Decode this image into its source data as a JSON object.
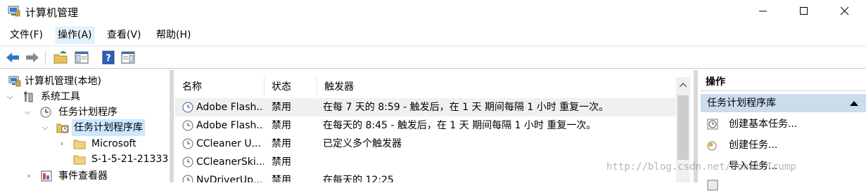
{
  "window": {
    "title": "计算机管理"
  },
  "menu": [
    "文件(F)",
    "操作(A)",
    "查看(V)",
    "帮助(H)"
  ],
  "toolbar": {
    "buttons": [
      "back-arrow-icon",
      "forward-arrow-icon",
      "up-folder-icon",
      "show-hide-tree-icon",
      "help-icon",
      "show-hide-action-pane-icon"
    ]
  },
  "tree": {
    "items": [
      {
        "label": "计算机管理(本地)"
      },
      {
        "label": "系统工具"
      },
      {
        "label": "任务计划程序"
      },
      {
        "label": "任务计划程序库"
      },
      {
        "label": "Microsoft"
      },
      {
        "label": "S-1-5-21-21333"
      },
      {
        "label": "事件查看器"
      }
    ]
  },
  "list": {
    "columns": [
      "名称",
      "状态",
      "触发器"
    ],
    "rows": [
      {
        "name": "Adobe Flash...",
        "status": "禁用",
        "trigger": "在每 7 天的 8:59 - 触发后，在 1 天 期间每隔 1 小时 重复一次。"
      },
      {
        "name": "Adobe Flash...",
        "status": "禁用",
        "trigger": "在每天的 8:45 - 触发后，在 1 天 期间每隔 1 小时 重复一次。"
      },
      {
        "name": "CCleaner U...",
        "status": "禁用",
        "trigger": "已定义多个触发器"
      },
      {
        "name": "CCleanerSki...",
        "status": "禁用",
        "trigger": ""
      },
      {
        "name": "NvDriverUp...",
        "status": "禁用",
        "trigger": "在每天的 12:25"
      }
    ]
  },
  "actions": {
    "header": "操作",
    "section": "任务计划程序库",
    "items": [
      "创建基本任务...",
      "创建任务...",
      "导入任务..."
    ]
  },
  "watermark": "http://blog.csdn.net/DonaldTrump",
  "colors": {
    "selection": "#cce8ff",
    "action_section": "#cbdcec",
    "menu_active": "#e5f3fb"
  }
}
